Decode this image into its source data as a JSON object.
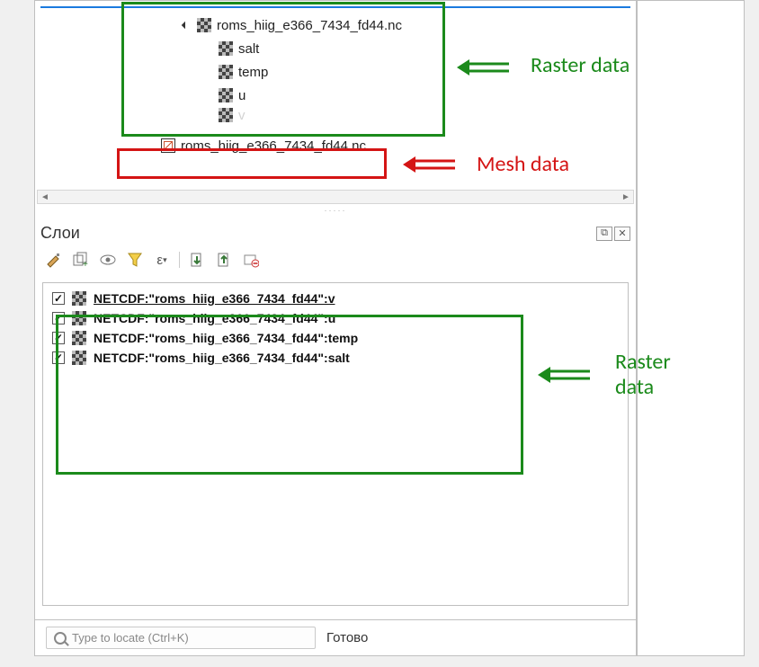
{
  "browser": {
    "root": {
      "label": "roms_hiig_e366_7434_fd44.nc",
      "expanded": true,
      "children": [
        {
          "label": "salt"
        },
        {
          "label": "temp"
        },
        {
          "label": "u"
        },
        {
          "label": "v"
        }
      ]
    },
    "mesh_item": {
      "label": "roms_hiig_e366_7434_fd44.nc"
    }
  },
  "layers_panel": {
    "title": "Слои",
    "dock_buttons": {
      "float": "⧉",
      "close": "✕"
    },
    "toolbar_icons": {
      "style": "style-icon",
      "add_group": "add-group-icon",
      "visibility": "eye-icon",
      "filter": "filter-icon",
      "expression": "expression-icon",
      "expand": "expand-icon",
      "collapse": "collapse-icon",
      "remove": "remove-icon"
    },
    "expression_label": "ε",
    "layers": [
      {
        "checked": true,
        "active": true,
        "label": "NETCDF:\"roms_hiig_e366_7434_fd44\":v"
      },
      {
        "checked": true,
        "active": false,
        "label": "NETCDF:\"roms_hiig_e366_7434_fd44\":u"
      },
      {
        "checked": true,
        "active": false,
        "label": "NETCDF:\"roms_hiig_e366_7434_fd44\":temp"
      },
      {
        "checked": true,
        "active": false,
        "label": "NETCDF:\"roms_hiig_e366_7434_fd44\":salt"
      }
    ]
  },
  "locator": {
    "placeholder": "Type to locate (Ctrl+K)"
  },
  "status": {
    "text": "Готово"
  },
  "annotations": {
    "raster_label": "Raster data",
    "mesh_label": "Mesh data",
    "raster_label2_line1": "Raster",
    "raster_label2_line2": "data"
  }
}
